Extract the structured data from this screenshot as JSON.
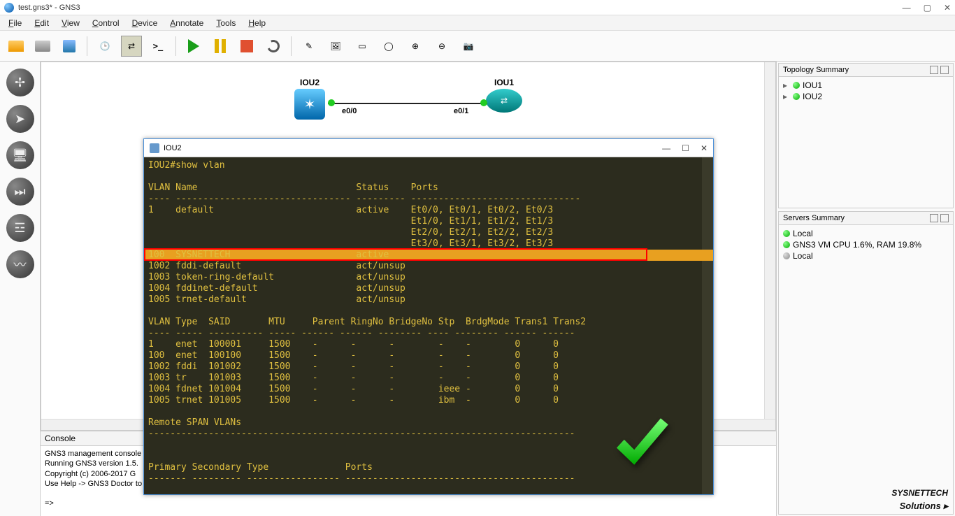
{
  "window": {
    "title": "test.gns3* - GNS3"
  },
  "menu": [
    "File",
    "Edit",
    "View",
    "Control",
    "Device",
    "Annotate",
    "Tools",
    "Help"
  ],
  "topology": {
    "nodes": [
      {
        "name": "IOU2",
        "type": "switch"
      },
      {
        "name": "IOU1",
        "type": "router"
      }
    ],
    "link": {
      "a_if": "e0/0",
      "b_if": "e0/1"
    }
  },
  "topology_summary": {
    "title": "Topology Summary",
    "items": [
      "IOU1",
      "IOU2"
    ]
  },
  "servers_summary": {
    "title": "Servers Summary",
    "items": [
      {
        "dot": "green",
        "text": "Local"
      },
      {
        "dot": "green",
        "text": "GNS3 VM CPU 1.6%, RAM 19.8%"
      },
      {
        "dot": "gray",
        "text": "Local"
      }
    ]
  },
  "console_panel": {
    "title": "Console",
    "lines": [
      "GNS3 management console",
      "Running GNS3 version 1.5.",
      "Copyright (c) 2006-2017 G",
      "Use Help -> GNS3 Doctor to",
      "",
      "=>"
    ]
  },
  "terminal": {
    "title": "IOU2",
    "prompt": "IOU2#",
    "command": "show vlan",
    "vlan_header": {
      "c1": "VLAN",
      "c2": "Name",
      "c3": "Status",
      "c4": "Ports"
    },
    "vlan_rows": [
      {
        "id": "1",
        "name": "default",
        "status": "active",
        "ports": "Et0/0, Et0/1, Et0/2, Et0/3"
      },
      {
        "id": "",
        "name": "",
        "status": "",
        "ports": "Et1/0, Et1/1, Et1/2, Et1/3"
      },
      {
        "id": "",
        "name": "",
        "status": "",
        "ports": "Et2/0, Et2/1, Et2/2, Et2/3"
      },
      {
        "id": "",
        "name": "",
        "status": "",
        "ports": "Et3/0, Et3/1, Et3/2, Et3/3"
      },
      {
        "id": "100",
        "name": "SYSNETTECH",
        "status": "active",
        "ports": "",
        "highlight": true
      },
      {
        "id": "1002",
        "name": "fddi-default",
        "status": "act/unsup",
        "ports": ""
      },
      {
        "id": "1003",
        "name": "token-ring-default",
        "status": "act/unsup",
        "ports": ""
      },
      {
        "id": "1004",
        "name": "fddinet-default",
        "status": "act/unsup",
        "ports": ""
      },
      {
        "id": "1005",
        "name": "trnet-default",
        "status": "act/unsup",
        "ports": ""
      }
    ],
    "detail_header": [
      "VLAN",
      "Type",
      "SAID",
      "MTU",
      "Parent",
      "RingNo",
      "BridgeNo",
      "Stp",
      "BrdgMode",
      "Trans1",
      "Trans2"
    ],
    "detail_rows": [
      [
        "1",
        "enet",
        "100001",
        "1500",
        "-",
        "-",
        "-",
        "-",
        "-",
        "0",
        "0"
      ],
      [
        "100",
        "enet",
        "100100",
        "1500",
        "-",
        "-",
        "-",
        "-",
        "-",
        "0",
        "0"
      ],
      [
        "1002",
        "fddi",
        "101002",
        "1500",
        "-",
        "-",
        "-",
        "-",
        "-",
        "0",
        "0"
      ],
      [
        "1003",
        "tr",
        "101003",
        "1500",
        "-",
        "-",
        "-",
        "-",
        "-",
        "0",
        "0"
      ],
      [
        "1004",
        "fdnet",
        "101004",
        "1500",
        "-",
        "-",
        "-",
        "ieee",
        "-",
        "0",
        "0"
      ],
      [
        "1005",
        "trnet",
        "101005",
        "1500",
        "-",
        "-",
        "-",
        "ibm",
        "-",
        "0",
        "0"
      ]
    ],
    "remote_span_title": "Remote SPAN VLANs",
    "secondary_header": [
      "Primary",
      "Secondary",
      "Type",
      "Ports"
    ]
  },
  "watermark": {
    "main": "SYSNETTECH",
    "sub": "Solutions"
  }
}
